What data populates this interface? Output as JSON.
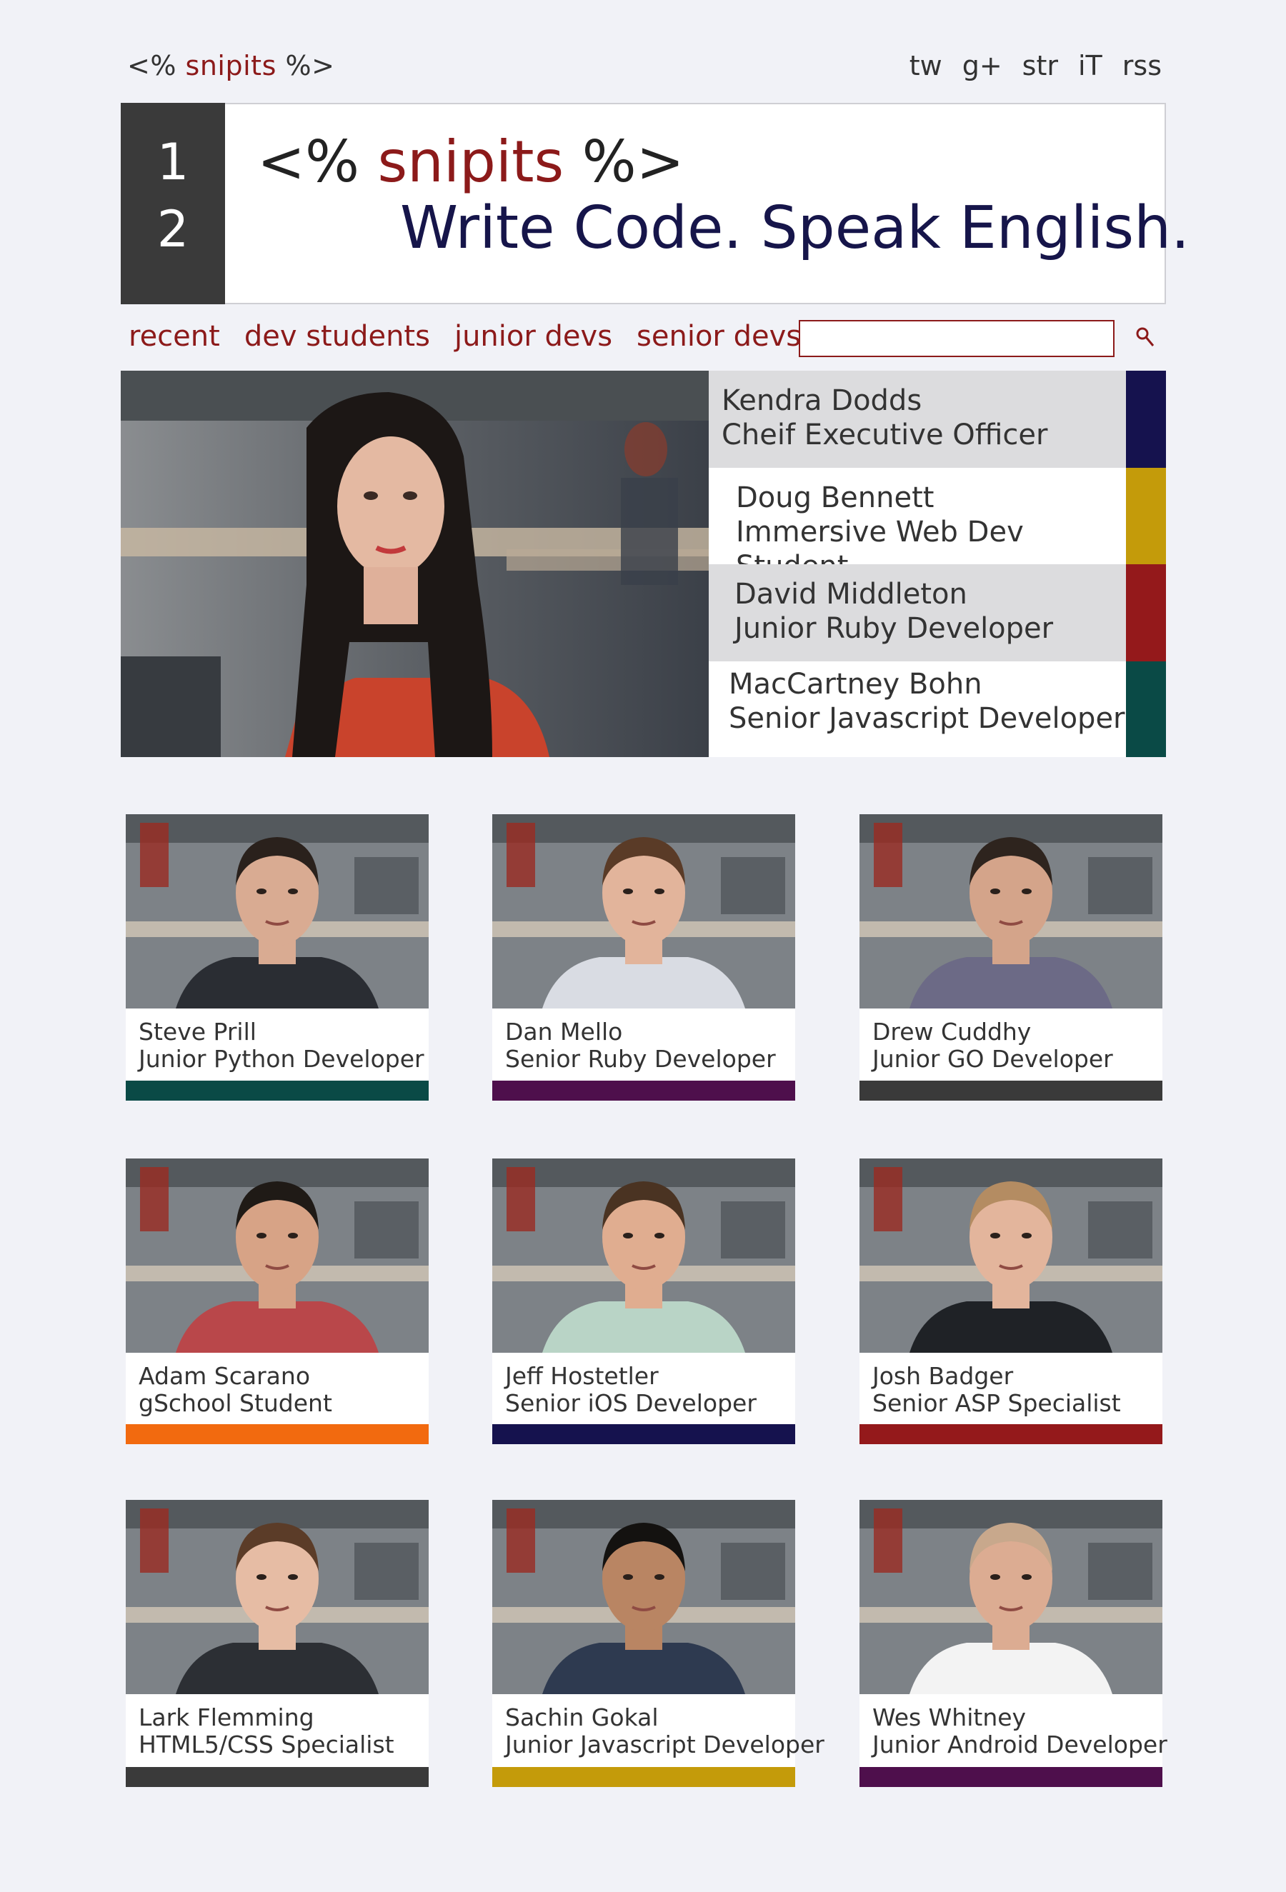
{
  "top": {
    "logo_prefix": "<%",
    "logo_word": "snipits",
    "logo_suffix": "%>",
    "social": [
      "tw",
      "g+",
      "str",
      "iT",
      "rss"
    ]
  },
  "header": {
    "issue_top": "1",
    "issue_bottom": "2",
    "brand_prefix": "<%",
    "brand_word": "snipits",
    "brand_suffix": "%>",
    "tagline": "Write Code. Speak English."
  },
  "nav": {
    "items": [
      "recent",
      "dev students",
      "junior devs",
      "senior devs"
    ],
    "search_placeholder": ""
  },
  "feature": {
    "items": [
      {
        "name": "Kendra Dodds",
        "role": "Cheif Executive Officer",
        "color": "#15124e"
      },
      {
        "name": "Doug Bennett",
        "role": "Immersive Web Dev Student",
        "color": "#c49b0a"
      },
      {
        "name": "David Middleton",
        "role": "Junior Ruby Developer",
        "color": "#94191b"
      },
      {
        "name": "MacCartney Bohn",
        "role": "Senior Javascript Developer",
        "color": "#0a4a46"
      }
    ]
  },
  "grid": {
    "cards": [
      {
        "name": "Steve Prill",
        "role": "Junior Python Developer",
        "color": "#0a4a46"
      },
      {
        "name": "Dan Mello",
        "role": "Senior Ruby Developer",
        "color": "#4e0f4c"
      },
      {
        "name": "Drew Cuddhy",
        "role": "Junior GO Developer",
        "color": "#3a3a3a"
      },
      {
        "name": "Adam Scarano",
        "role": "gSchool Student",
        "color": "#f26a0f"
      },
      {
        "name": "Jeff Hostetler",
        "role": "Senior iOS Developer",
        "color": "#15124e"
      },
      {
        "name": "Josh Badger",
        "role": "Senior ASP Specialist",
        "color": "#94191b"
      },
      {
        "name": "Lark Flemming",
        "role": "HTML5/CSS Specialist",
        "color": "#3a3a3a"
      },
      {
        "name": "Sachin Gokal",
        "role": "Junior Javascript Developer",
        "color": "#c49b0a"
      },
      {
        "name": "Wes Whitney",
        "role": "Junior Android Developer",
        "color": "#4e0f4c"
      }
    ]
  }
}
